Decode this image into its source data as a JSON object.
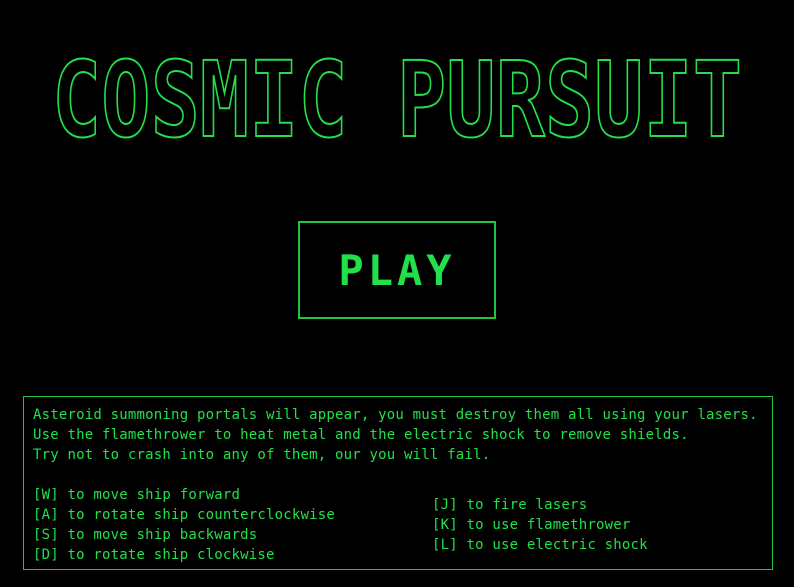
{
  "title": "COSMIC PURSUIT",
  "play_button": {
    "label": "PLAY"
  },
  "instructions": {
    "intro": [
      "Asteroid summoning portals will appear, you must destroy them all using your lasers.",
      "Use the flamethrower to heat metal and the electric shock to remove shields.",
      "Try not to crash into any of them, our you will fail."
    ],
    "movement_controls": [
      "[W] to move ship forward",
      "[A] to rotate ship counterclockwise",
      "[S] to move ship backwards",
      "[D] to rotate ship clockwise"
    ],
    "weapon_controls": [
      "[J] to fire lasers",
      "[K] to use flamethrower",
      "[L] to use electric shock"
    ]
  },
  "colors": {
    "background": "#000000",
    "primary_green": "#22e04a",
    "border_green": "#1fc43f"
  }
}
